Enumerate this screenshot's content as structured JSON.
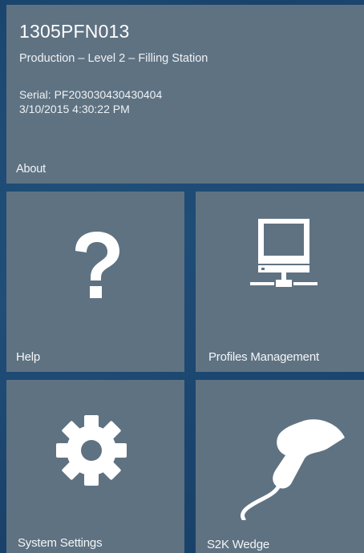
{
  "device": {
    "name": "1305PFN013",
    "location": "Production – Level 2 – Filling Station",
    "serial": "Serial: PF203030430430404",
    "datetime": "3/10/2015 4:30:22 PM"
  },
  "tiles": {
    "about": {
      "label": "About",
      "icon": "info"
    },
    "help": {
      "label": "Help",
      "icon": "question-mark-icon"
    },
    "profiles": {
      "label": "Profiles Management",
      "icon": "monitor-network-icon"
    },
    "settings": {
      "label": "System Settings",
      "icon": "gear-icon"
    },
    "wedge": {
      "label": "S2K Wedge",
      "icon": "barcode-scanner-icon"
    }
  },
  "colors": {
    "tile": "#5f7282",
    "background": "#1f4f78",
    "icon": "#ffffff"
  }
}
